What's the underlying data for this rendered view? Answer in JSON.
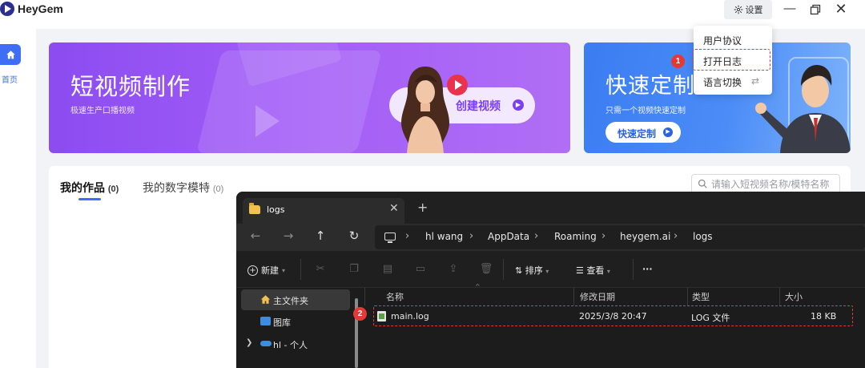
{
  "app": {
    "name": "HeyGem",
    "settings_label": "设置"
  },
  "sidebar": {
    "home_label": "首页"
  },
  "banner_create": {
    "title": "短视频制作",
    "subtitle": "极速生产口播视频",
    "button_label": "创建视频"
  },
  "banner_custom": {
    "title": "快速定制",
    "subtitle": "只需一个视频快速定制",
    "button_label": "快速定制"
  },
  "works": {
    "tab_works": "我的作品",
    "tab_works_count": "(0)",
    "tab_models": "我的数字模特",
    "tab_models_count": "(0)",
    "search_placeholder": "请输入短视频名称/模特名称"
  },
  "settings_menu": {
    "items": [
      "用户协议",
      "打开日志",
      "语言切换"
    ]
  },
  "steps": [
    "1",
    "2"
  ],
  "explorer": {
    "tab_title": "logs",
    "breadcrumb": [
      "hl wang",
      "AppData",
      "Roaming",
      "heygem.ai",
      "logs"
    ],
    "toolbar": {
      "new_label": "新建",
      "sort_label": "排序",
      "view_label": "查看",
      "more_label": "···"
    },
    "nav": [
      {
        "label": "主文件夹"
      },
      {
        "label": "图库"
      },
      {
        "label": "hl - 个人"
      }
    ],
    "columns": [
      "名称",
      "修改日期",
      "类型",
      "大小"
    ],
    "files": [
      {
        "name": "main.log",
        "modified": "2025/3/8 20:47",
        "type": "LOG 文件",
        "size": "18 KB"
      }
    ]
  },
  "colors": {
    "accent": "#3d6ef5",
    "banner_purple": "#9a56f5",
    "banner_blue": "#4285f4",
    "highlight_red": "#e53935",
    "explorer_bg": "#1c1c1c"
  }
}
